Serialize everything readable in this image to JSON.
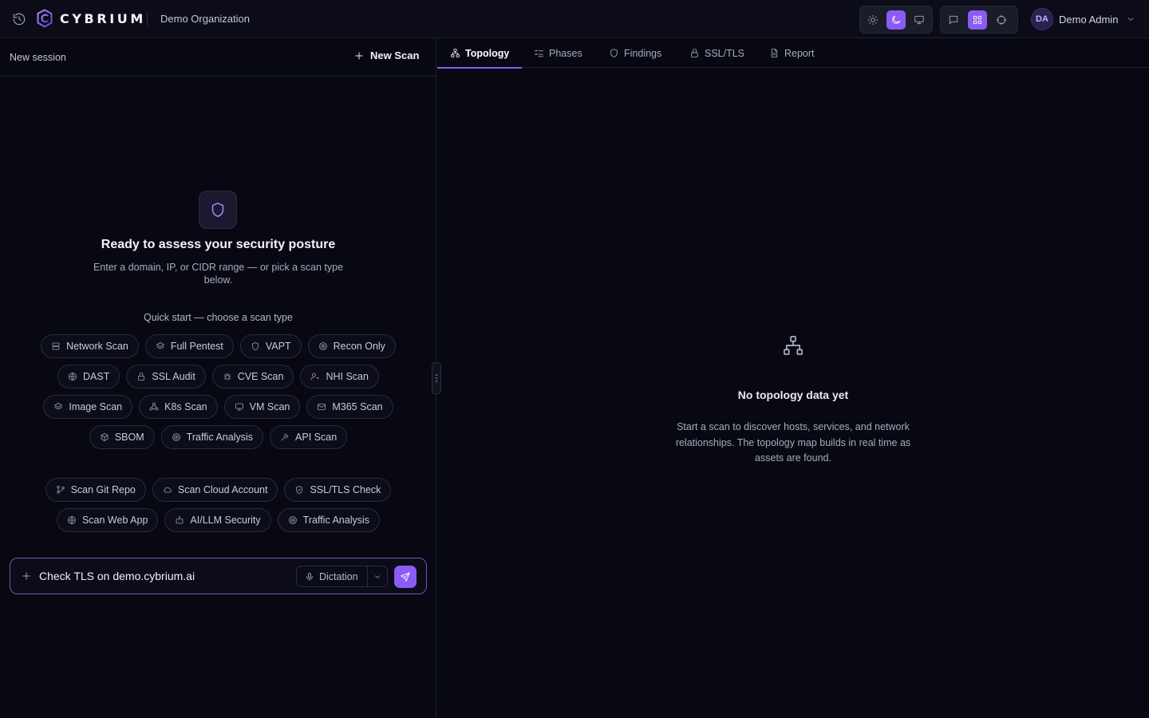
{
  "app": {
    "brand": "CYBRIUM",
    "organization": "Demo Organization",
    "accent_color": "#8a5cf5",
    "user": {
      "initials": "DA",
      "name": "Demo Admin"
    },
    "theme_toggle": {
      "options": [
        "sun-icon",
        "moon-icon",
        "monitor-icon"
      ],
      "active": "moon-icon"
    },
    "view_toggle": {
      "options": [
        "chat-icon",
        "grid-icon",
        "crosshair-icon"
      ],
      "active": "grid-icon"
    }
  },
  "left_panel": {
    "session_label": "New session",
    "new_scan_label": "New Scan",
    "hero_title": "Ready to assess your security posture",
    "hero_subtitle": "Enter a domain, IP, or CIDR range — or pick a scan type below.",
    "quick_start_title": "Quick start — choose a scan type",
    "scan_types": [
      {
        "label": "Network Scan",
        "icon": "server-icon"
      },
      {
        "label": "Full Pentest",
        "icon": "layers-icon"
      },
      {
        "label": "VAPT",
        "icon": "shield-icon"
      },
      {
        "label": "Recon Only",
        "icon": "radar-icon"
      },
      {
        "label": "DAST",
        "icon": "globe-icon"
      },
      {
        "label": "SSL Audit",
        "icon": "lock-icon"
      },
      {
        "label": "CVE Scan",
        "icon": "bug-icon"
      },
      {
        "label": "NHI Scan",
        "icon": "user-key-icon"
      },
      {
        "label": "Image Scan",
        "icon": "layers-icon"
      },
      {
        "label": "K8s Scan",
        "icon": "cluster-icon"
      },
      {
        "label": "VM Scan",
        "icon": "monitor-icon"
      },
      {
        "label": "M365 Scan",
        "icon": "mail-icon"
      },
      {
        "label": "SBOM",
        "icon": "box-icon"
      },
      {
        "label": "Traffic Analysis",
        "icon": "radar-icon"
      },
      {
        "label": "API Scan",
        "icon": "plug-icon"
      }
    ],
    "quick_actions": [
      {
        "label": "Scan Git Repo",
        "icon": "git-branch-icon"
      },
      {
        "label": "Scan Cloud Account",
        "icon": "cloud-icon"
      },
      {
        "label": "SSL/TLS Check",
        "icon": "shield-check-icon"
      },
      {
        "label": "Scan Web App",
        "icon": "globe-icon"
      },
      {
        "label": "AI/LLM Security",
        "icon": "bot-icon"
      },
      {
        "label": "Traffic Analysis",
        "icon": "radar-icon"
      }
    ],
    "composer": {
      "value": "Check TLS on demo.cybrium.ai",
      "dictation_label": "Dictation"
    }
  },
  "right_panel": {
    "tabs": [
      {
        "label": "Topology",
        "icon": "topology-icon",
        "active": true
      },
      {
        "label": "Phases",
        "icon": "list-check-icon",
        "active": false
      },
      {
        "label": "Findings",
        "icon": "shield-icon",
        "active": false
      },
      {
        "label": "SSL/TLS",
        "icon": "lock-icon",
        "active": false
      },
      {
        "label": "Report",
        "icon": "file-icon",
        "active": false
      }
    ],
    "empty_title": "No topology data yet",
    "empty_text": "Start a scan to discover hosts, services, and network relationships. The topology map builds in real time as assets are found."
  }
}
